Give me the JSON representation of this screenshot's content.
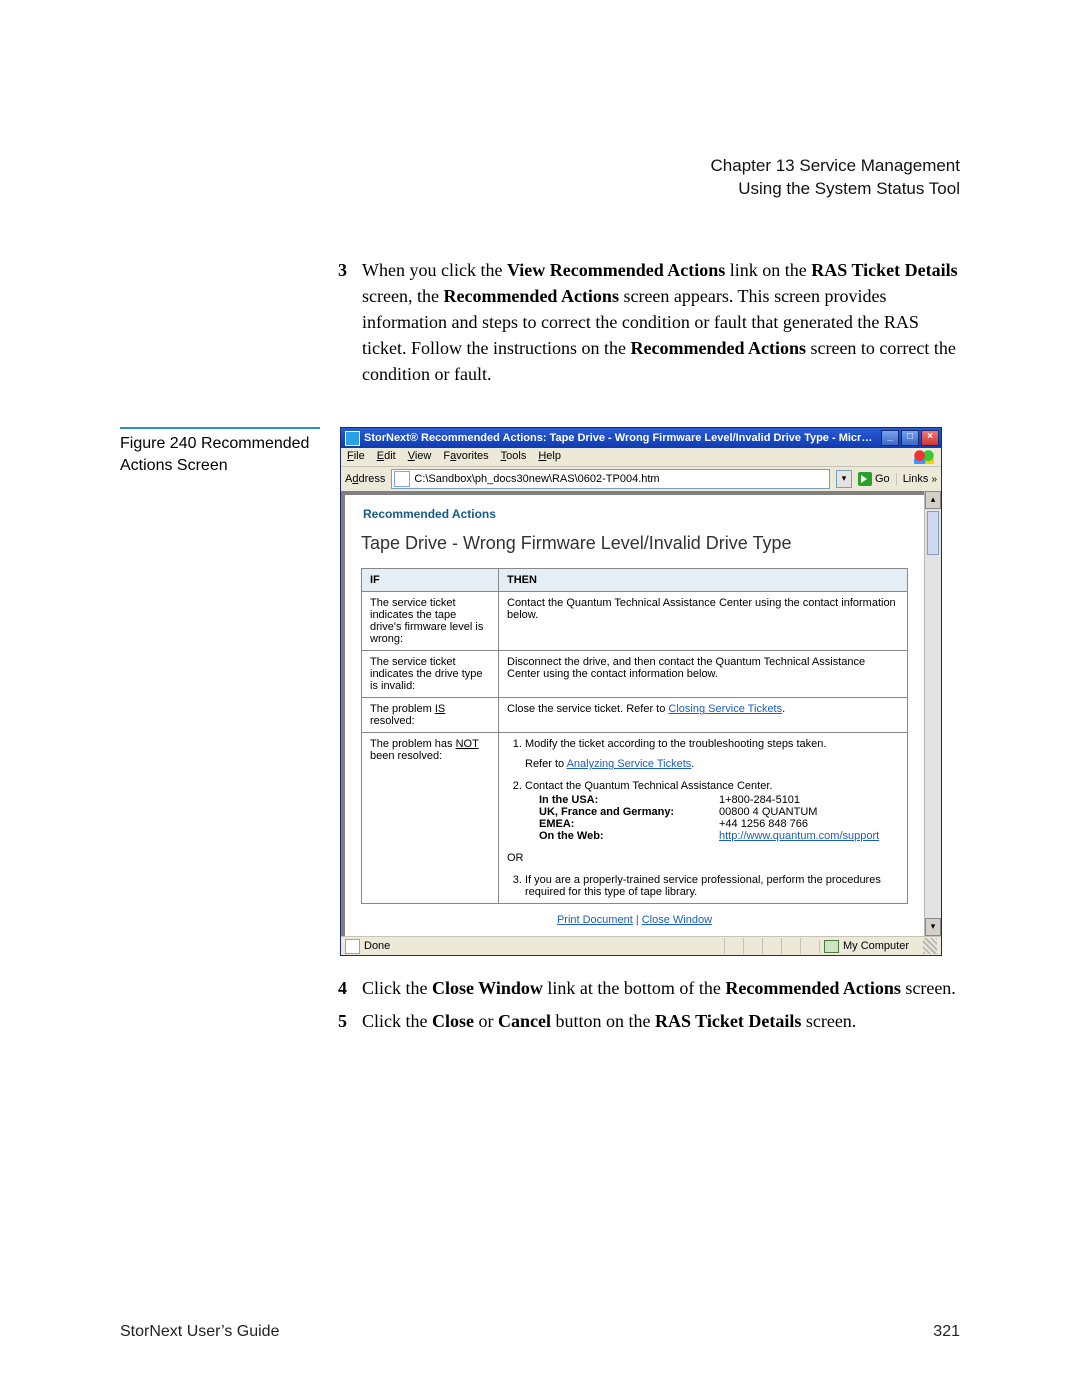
{
  "header": {
    "chapter": "Chapter 13  Service Management",
    "section": "Using the System Status Tool"
  },
  "intro_step": {
    "number": "3",
    "part1": "When you click the ",
    "bold1": "View Recommended Actions",
    "part2": " link on the ",
    "bold2": "RAS Ticket Details",
    "part3": " screen, the ",
    "bold3": "Recommended Actions",
    "part4": " screen appears. This screen provides information and steps to correct the condition or fault that generated the RAS ticket. Follow the instructions on the ",
    "bold4": "Recommended Actions",
    "part5": " screen to correct the condition or fault."
  },
  "figure_caption": "Figure 240   Recommended Actions Screen",
  "ie": {
    "title": "StorNext® Recommended Actions: Tape Drive - Wrong Firmware Level/Invalid Drive Type - Microsoft...",
    "menu": [
      "File",
      "Edit",
      "View",
      "Favorites",
      "Tools",
      "Help"
    ],
    "addr_label": "Address",
    "addr_value": "C:\\Sandbox\\ph_docs30new\\RAS\\0602-TP004.htm",
    "go_label": "Go",
    "links_label": "Links",
    "status_done": "Done",
    "status_zone": "My Computer"
  },
  "content": {
    "section_heading": "Recommended Actions",
    "page_title": "Tape Drive - Wrong Firmware Level/Invalid Drive Type",
    "th_if": "IF",
    "th_then": "THEN",
    "rows": {
      "r1": {
        "if": "The service ticket indicates the tape drive's firmware level is wrong:",
        "then": "Contact the Quantum Technical Assistance Center using the contact information below."
      },
      "r2": {
        "if": "The service ticket indicates the drive type is invalid:",
        "then": "Disconnect the drive, and then contact the Quantum Technical Assistance Center using the contact information below."
      },
      "r3": {
        "if_pre": "The problem ",
        "if_u": "IS",
        "if_post": " resolved:",
        "then_pre": "Close the service ticket. Refer to ",
        "then_link": "Closing Service Tickets",
        "then_post": "."
      },
      "r4": {
        "if_pre": "The problem has ",
        "if_u": "NOT",
        "if_post": " been resolved:",
        "li1": "Modify the ticket according to the troubleshooting steps taken.",
        "li1_ref_pre": "Refer to ",
        "li1_ref_link": "Analyzing Service Tickets",
        "li1_ref_post": ".",
        "li2_lead": "Contact the Quantum Technical Assistance Center.",
        "c_usa_k": "In the USA:",
        "c_usa_v": "1+800-284-5101",
        "c_eu_k": "UK, France and Germany:",
        "c_eu_v": "00800 4 QUANTUM",
        "c_emea_k": "EMEA:",
        "c_emea_v": "+44 1256 848 766",
        "c_web_k": "On the Web:",
        "c_web_v": "http://www.quantum.com/support",
        "or": "OR",
        "li3": "If you are a properly-trained service professional, perform the procedures required for this type of tape library."
      }
    },
    "print_link": "Print Document",
    "close_link": "Close Window"
  },
  "after_steps": {
    "s4": {
      "num": "4",
      "p1": "Click the ",
      "b1": "Close Window",
      "p2": " link at the bottom of the ",
      "b2": "Recommended Actions",
      "p3": " screen."
    },
    "s5": {
      "num": "5",
      "p1": "Click the ",
      "b1": "Close",
      "p2": " or ",
      "b2": "Cancel",
      "p3": " button on the ",
      "b3": "RAS Ticket Details",
      "p4": " screen."
    }
  },
  "footer": {
    "left": "StorNext User’s Guide",
    "right": "321"
  }
}
